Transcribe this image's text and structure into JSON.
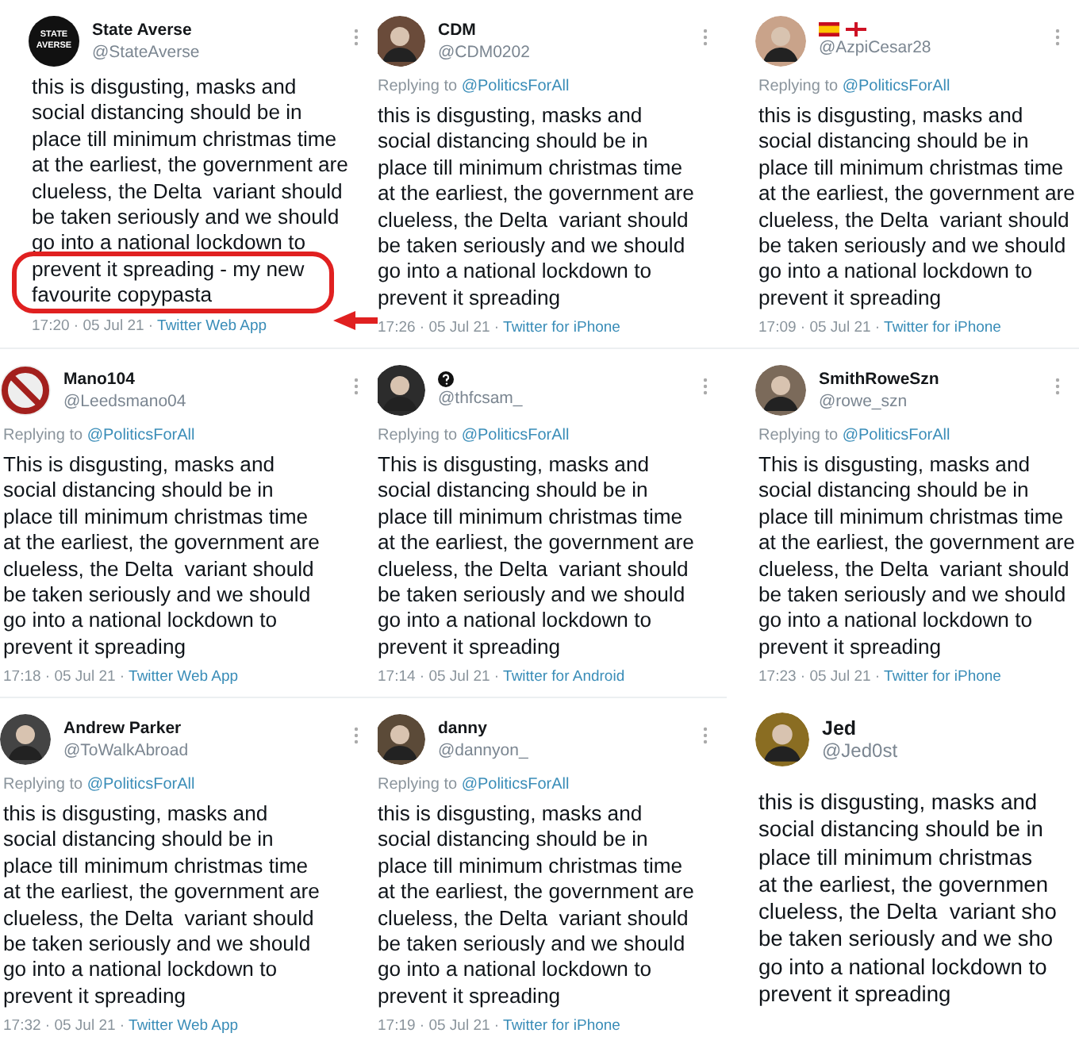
{
  "tweets": [
    {
      "kind": "standard",
      "name": "State Averse",
      "handle": "@StateAverse",
      "avatar": {
        "kind": "logo",
        "lines": [
          "STATE",
          "AVERSE"
        ]
      },
      "lines": [
        "this is disgusting, masks and",
        "social distancing should be in",
        "place till minimum christmas time",
        "at the earliest, the government are",
        "clueless, the Delta  variant should",
        "be taken seriously and we should",
        "go into a national lockdown to",
        "prevent it spreading - my new",
        "favourite copypasta"
      ],
      "circled": true,
      "time": "17:20 · 05 Jul 21 ·",
      "source": "Twitter Web App"
    },
    {
      "kind": "standard",
      "name": "CDM",
      "handle": "@CDM0202",
      "avatar": {
        "kind": "photo"
      },
      "reply_label": "Replying to",
      "reply_target": "@PoliticsForAll",
      "lines": [
        "this is disgusting, masks and",
        "social distancing should be in",
        "place till minimum christmas time",
        "at the earliest, the government are",
        "clueless, the Delta  variant should",
        "be taken seriously and we should",
        "go into a national lockdown to",
        "prevent it spreading"
      ],
      "time": "17:26 · 05 Jul 21 ·",
      "source": "Twitter for iPhone"
    },
    {
      "kind": "standard",
      "name_badge": {
        "kind": "flags"
      },
      "handle": "@AzpiCesar28",
      "avatar": {
        "kind": "photo"
      },
      "reply_label": "Replying to",
      "reply_target": "@PoliticsForAll",
      "lines": [
        "this is disgusting, masks and",
        "social distancing should be in",
        "place till minimum christmas time",
        "at the earliest, the government are",
        "clueless, the Delta  variant should",
        "be taken seriously and we should",
        "go into a national lockdown to",
        "prevent it spreading"
      ],
      "time": "17:09 · 05 Jul 21 ·",
      "source": "Twitter for iPhone"
    },
    {
      "kind": "standard",
      "name": "Mano104",
      "handle": "@Leedsmano04",
      "avatar": {
        "kind": "prohibited"
      },
      "reply_label": "Replying to",
      "reply_target": "@PoliticsForAll",
      "lines": [
        "This is disgusting, masks and",
        "social distancing should be in",
        "place till minimum christmas time",
        "at the earliest, the government are",
        "clueless, the Delta  variant should",
        "be taken seriously and we should",
        "go into a national lockdown to",
        "prevent it spreading"
      ],
      "time": "17:18 · 05 Jul 21 ·",
      "source": "Twitter Web App"
    },
    {
      "kind": "standard",
      "name_badge": {
        "kind": "question"
      },
      "handle": "@thfcsam_",
      "avatar": {
        "kind": "photo"
      },
      "reply_label": "Replying to",
      "reply_target": "@PoliticsForAll",
      "lines": [
        "This is disgusting, masks and",
        "social distancing should be in",
        "place till minimum christmas time",
        "at the earliest, the government are",
        "clueless, the Delta  variant should",
        "be taken seriously and we should",
        "go into a national lockdown to",
        "prevent it spreading"
      ],
      "time": "17:14 · 05 Jul 21 ·",
      "source": "Twitter for Android"
    },
    {
      "kind": "standard",
      "name": "SmithRoweSzn",
      "handle": "@rowe_szn",
      "avatar": {
        "kind": "photo"
      },
      "reply_label": "Replying to",
      "reply_target": "@PoliticsForAll",
      "lines": [
        "This is disgusting, masks and",
        "social distancing should be in",
        "place till minimum christmas time",
        "at the earliest, the government are",
        "clueless, the Delta  variant should",
        "be taken seriously and we should",
        "go into a national lockdown to",
        "prevent it spreading"
      ],
      "time": "17:23 · 05 Jul 21 ·",
      "source": "Twitter for iPhone"
    },
    {
      "kind": "standard",
      "name": "Andrew Parker",
      "handle": "@ToWalkAbroad",
      "avatar": {
        "kind": "photo"
      },
      "reply_label": "Replying to",
      "reply_target": "@PoliticsForAll",
      "lines": [
        "this is disgusting, masks and",
        "social distancing should be in",
        "place till minimum christmas time",
        "at the earliest, the government are",
        "clueless, the Delta  variant should",
        "be taken seriously and we should",
        "go into a national lockdown to",
        "prevent it spreading"
      ],
      "time": "17:32 · 05 Jul 21 ·",
      "source": "Twitter Web App"
    },
    {
      "kind": "standard",
      "name": "danny",
      "handle": "@dannyon_",
      "avatar": {
        "kind": "photo"
      },
      "reply_label": "Replying to",
      "reply_target": "@PoliticsForAll",
      "lines": [
        "this is disgusting, masks and",
        "social distancing should be in",
        "place till minimum christmas time",
        "at the earliest, the government are",
        "clueless, the Delta  variant should",
        "be taken seriously and we should",
        "go into a national lockdown to",
        "prevent it spreading"
      ],
      "time": "17:19 · 05 Jul 21 ·",
      "source": "Twitter for iPhone"
    },
    {
      "kind": "zoomed",
      "name": "Jed",
      "handle": "@Jed0st",
      "avatar": {
        "kind": "photo"
      },
      "lines": [
        "this is disgusting, masks and",
        "social distancing should be in",
        "place till minimum christmas",
        "at the earliest, the governmen",
        "clueless, the Delta  variant sho",
        "be taken seriously and we sho",
        "go into a national lockdown to",
        "prevent it spreading"
      ]
    }
  ]
}
